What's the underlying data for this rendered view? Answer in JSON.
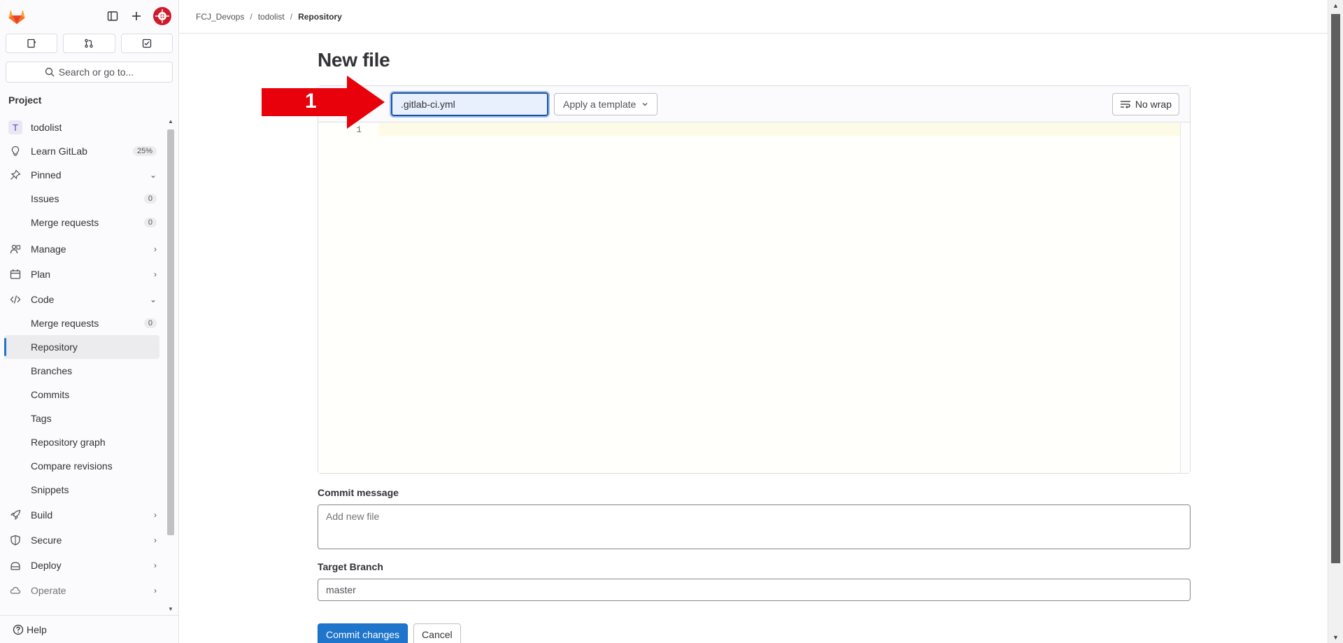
{
  "sidebar": {
    "search_placeholder": "Search or go to...",
    "section_title": "Project",
    "project_initial": "T",
    "items": [
      {
        "label": "todolist"
      },
      {
        "label": "Learn GitLab",
        "badge": "25%"
      },
      {
        "label": "Pinned"
      },
      {
        "label": "Issues",
        "badge": "0"
      },
      {
        "label": "Merge requests",
        "badge": "0"
      },
      {
        "label": "Manage"
      },
      {
        "label": "Plan"
      },
      {
        "label": "Code"
      },
      {
        "label": "Merge requests",
        "badge": "0"
      },
      {
        "label": "Repository"
      },
      {
        "label": "Branches"
      },
      {
        "label": "Commits"
      },
      {
        "label": "Tags"
      },
      {
        "label": "Repository graph"
      },
      {
        "label": "Compare revisions"
      },
      {
        "label": "Snippets"
      },
      {
        "label": "Build"
      },
      {
        "label": "Secure"
      },
      {
        "label": "Deploy"
      },
      {
        "label": "Operate"
      }
    ],
    "help_label": "Help"
  },
  "breadcrumb": {
    "items": [
      "FCJ_Devops",
      "todolist",
      "Repository"
    ],
    "separator": "/"
  },
  "page": {
    "title": "New file"
  },
  "editor": {
    "file_name_value": ".gitlab-ci.yml",
    "template_button": "Apply a template",
    "nowrap_button": "No wrap",
    "line_number": "1"
  },
  "commit": {
    "label": "Commit message",
    "placeholder": "Add new file"
  },
  "branch": {
    "label": "Target Branch",
    "value": "master"
  },
  "actions": {
    "commit_button": "Commit changes",
    "cancel_button": "Cancel"
  },
  "annotation": {
    "step_number": "1",
    "color": "#e8000b"
  },
  "colors": {
    "primary": "#1f75cb",
    "active_indicator": "#1f75cb",
    "avatar": "#d1192c"
  }
}
